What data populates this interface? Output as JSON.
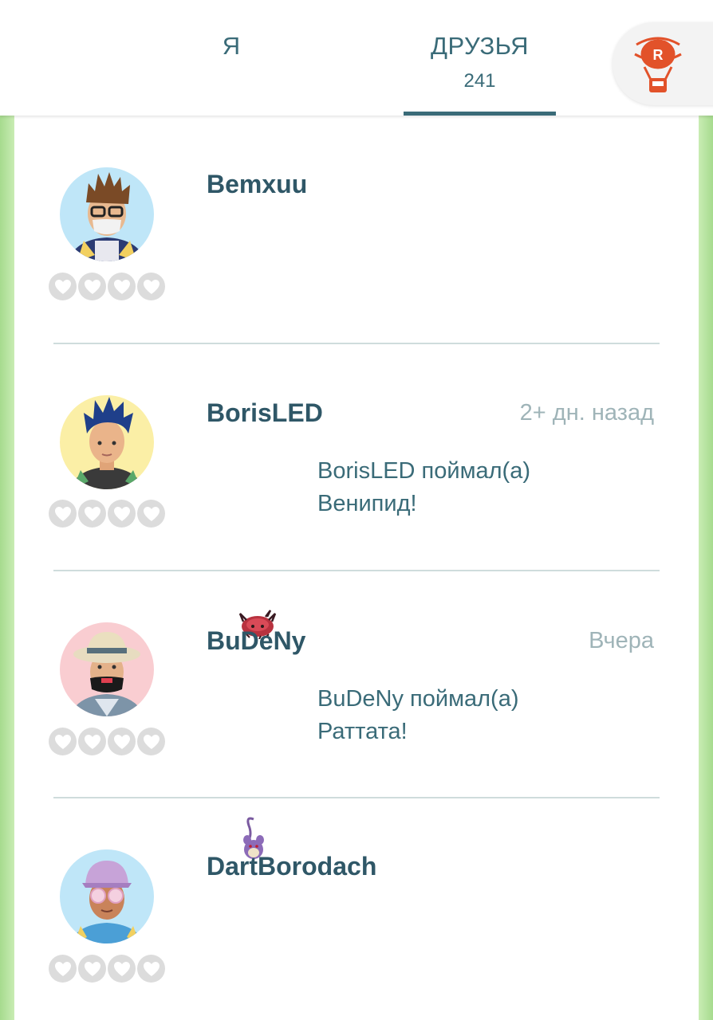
{
  "header": {
    "tabs": [
      {
        "label": "Я",
        "active": false
      },
      {
        "label": "ДРУЗЬЯ",
        "count": "241",
        "active": true
      }
    ],
    "accent_color": "#3a6b78",
    "balloon_icon": "team-rocket-balloon-icon",
    "balloon_color": "#e2522a"
  },
  "friends": [
    {
      "name": "Bemxuu",
      "time": "",
      "activity_line1": "",
      "activity_line2": "",
      "activity_icon": "",
      "hearts": 0,
      "avatar_bg": "#bfe6f8"
    },
    {
      "name": "BorisLED",
      "time": "2+ дн. назад",
      "activity_line1": "BorisLED поймал(а)",
      "activity_line2": "Венипид!",
      "activity_icon": "venipede-icon",
      "hearts": 0,
      "avatar_bg": "#fbefa6"
    },
    {
      "name": "BuDeNy",
      "time": "Вчера",
      "activity_line1": "BuDeNy поймал(а)",
      "activity_line2": "Раттата!",
      "activity_icon": "rattata-icon",
      "hearts": 0,
      "avatar_bg": "#f9cdd1"
    },
    {
      "name": "DartBorodach",
      "time": "",
      "activity_line1": "",
      "activity_line2": "",
      "activity_icon": "",
      "hearts": 0,
      "avatar_bg": "#bfe6f8"
    }
  ],
  "heart_icon": "heart-outline-icon"
}
